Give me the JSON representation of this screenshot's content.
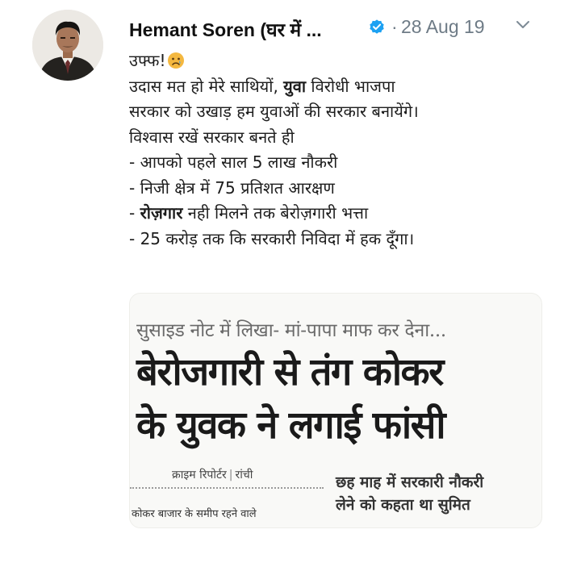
{
  "tweet": {
    "author_name": "Hemant Soren (घर में ...",
    "separator": "·",
    "date": "28 Aug 19",
    "icons": {
      "avatar": "profile-photo",
      "verified": "verified-badge-icon",
      "menu": "chevron-down-icon",
      "emoji": "sad-face-emoji-icon"
    },
    "accent_color": "#1da1f2",
    "text": {
      "l1": "उफ्फ!",
      "l2_a": "उदास मत हो मेरे साथियों, ",
      "l2_b": "युवा",
      "l2_c": " विरोधी भाजपा",
      "l3": "सरकार को उखाड़ हम युवाओं की सरकार बनायेंगे।",
      "l4": "विश्वास रखें सरकार बनते ही",
      "l5": "- आपको पहले साल 5 लाख नौकरी",
      "l6": "- निजी क्षेत्र में 75 प्रतिशत आरक्षण",
      "l7_a": "- ",
      "l7_b": "रोज़गार",
      "l7_c": " नही मिलने तक बेरोज़गारी भत्ता",
      "l8": "- 25 करोड़ तक कि सरकारी निविदा में हक दूँगा।"
    },
    "clipping": {
      "subhead": "सुसाइड नोट में लिखा- मां-पापा माफ कर देना...",
      "headline_1": "बेरोजगारी से तंग कोकर",
      "headline_2": "के युवक ने लगाई फांसी",
      "byline_reporter": "क्राइम रिपोर्टर",
      "byline_sep": "|",
      "byline_city": "रांची",
      "body_snippet": "कोकर बाजार के समीप रहने वाले",
      "sub2_line1": "छह माह में सरकारी नौकरी",
      "sub2_line2": "लेने को कहता था सुमित"
    }
  }
}
